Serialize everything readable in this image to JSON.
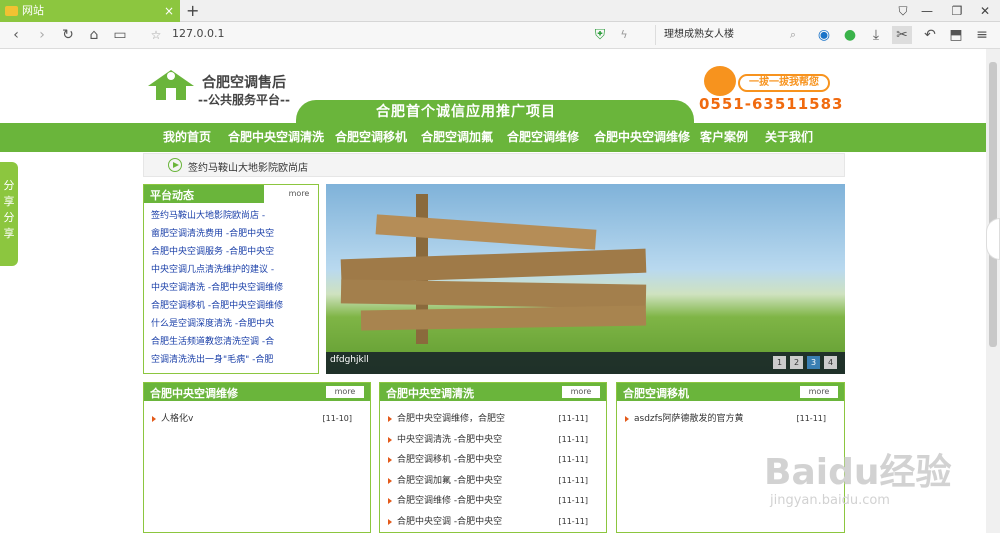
{
  "browser": {
    "tab_title": "网站",
    "address": "127.0.0.1",
    "search_text": "理想成熟女人楼",
    "colors": {
      "tab": "#8cc63f",
      "accent": "#6ab53b"
    }
  },
  "site": {
    "logo_title": "合肥空调售后",
    "logo_subtitle": "--公共服务平台--",
    "slogan": "合肥首个诚信应用推广项目",
    "hotline_bubble": "一拔一拔我帮您",
    "phone": "0551-63511583",
    "nav": [
      "我的首页",
      "合肥中央空调清洗",
      "合肥空调移机",
      "合肥空调加氟",
      "合肥空调维修",
      "合肥中央空调维修",
      "客户案例",
      "关于我们"
    ],
    "notice": "签约马鞍山大地影院欧尚店",
    "share_label": [
      "分",
      "享",
      "分",
      "享"
    ]
  },
  "platform": {
    "title": "平台动态",
    "more": "more",
    "items": [
      "签约马鞍山大地影院欧尚店 -",
      "畲肥空调清洗费用 -合肥中央空",
      "合肥中央空调服务 -合肥中央空",
      "中央空调几点清洗维护的建议 -",
      "中央空调清洗 -合肥中央空调维修",
      "合肥空调移机 -合肥中央空调维修",
      "什么是空调深度清洗 -合肥中央",
      "合肥生活频道教您清洗空调 -合",
      "空调清洗洗出一身\"毛病\" -合肥"
    ]
  },
  "banner": {
    "caption": "dfdghjkll",
    "pages": [
      "1",
      "2",
      "3",
      "4"
    ],
    "active_page": "3"
  },
  "panels": [
    {
      "title": "合肥中央空调维修",
      "more": "more",
      "rows": [
        {
          "text": "人格化v",
          "date": "[11-10]"
        }
      ]
    },
    {
      "title": "合肥中央空调清洗",
      "more": "more",
      "rows": [
        {
          "text": "合肥中央空调维修，合肥空",
          "date": "[11-11]"
        },
        {
          "text": "中央空调清洗 -合肥中央空",
          "date": "[11-11]"
        },
        {
          "text": "合肥空调移机 -合肥中央空",
          "date": "[11-11]"
        },
        {
          "text": "合肥空调加氟 -合肥中央空",
          "date": "[11-11]"
        },
        {
          "text": "合肥空调维修 -合肥中央空",
          "date": "[11-11]"
        },
        {
          "text": "合肥中央空调 -合肥中央空",
          "date": "[11-11]"
        }
      ]
    },
    {
      "title": "合肥空调移机",
      "more": "more",
      "rows": [
        {
          "text": "asdzfs阿萨德散发的官方黄",
          "date": "[11-11]"
        }
      ]
    }
  ],
  "watermark": {
    "main": "Baidu经验",
    "sub": "jingyan.baidu.com"
  }
}
